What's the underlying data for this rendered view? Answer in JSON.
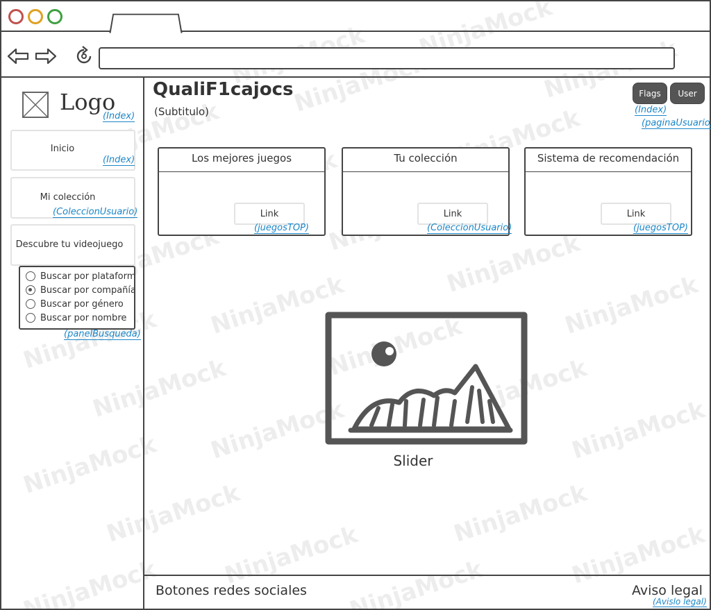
{
  "browser": {
    "window_controls": [
      "close",
      "minimize",
      "maximize"
    ],
    "icons": {
      "back": "back-arrow-icon",
      "forward": "forward-arrow-icon",
      "reload": "reload-icon"
    },
    "url": ""
  },
  "sidebar": {
    "logo_label": "Logo",
    "logo_link": "(Index)",
    "items": [
      {
        "label": "Inicio",
        "link": "(Index)"
      },
      {
        "label": "Mi colección",
        "link": "(ColeccionUsuario)"
      },
      {
        "label": "Descubre tu videojuego"
      }
    ],
    "search_panel": {
      "options": [
        {
          "label": "Buscar por plataforma",
          "checked": false
        },
        {
          "label": "Buscar por compañía",
          "checked": true
        },
        {
          "label": "Buscar por género",
          "checked": false
        },
        {
          "label": "Buscar por nombre",
          "checked": false
        }
      ],
      "link": "(panelBusqueda)"
    }
  },
  "header": {
    "title": "QualiF1cajocs",
    "subtitle": "(Subtitulo)",
    "buttons": [
      {
        "label": "Flags",
        "link": "(Index)"
      },
      {
        "label": "User",
        "link": "(paginaUsuario)"
      }
    ]
  },
  "cards": [
    {
      "title": "Los mejores juegos",
      "link_label": "Link",
      "link": "(juegosTOP)"
    },
    {
      "title": "Tu colección",
      "link_label": "Link",
      "link": "(ColeccionUsuario)"
    },
    {
      "title": "Sistema de recomendación",
      "link_label": "Link",
      "link": "(juegosTOP)"
    }
  ],
  "slider": {
    "label": "Slider",
    "icon": "image-placeholder-icon"
  },
  "footer": {
    "left": "Botones redes sociales",
    "right": "Aviso legal",
    "right_link": "(Avislo legal)"
  },
  "watermark": "NinjaMock",
  "colors": {
    "link": "#1a86c8",
    "button": "#555555",
    "border": "#444444"
  }
}
